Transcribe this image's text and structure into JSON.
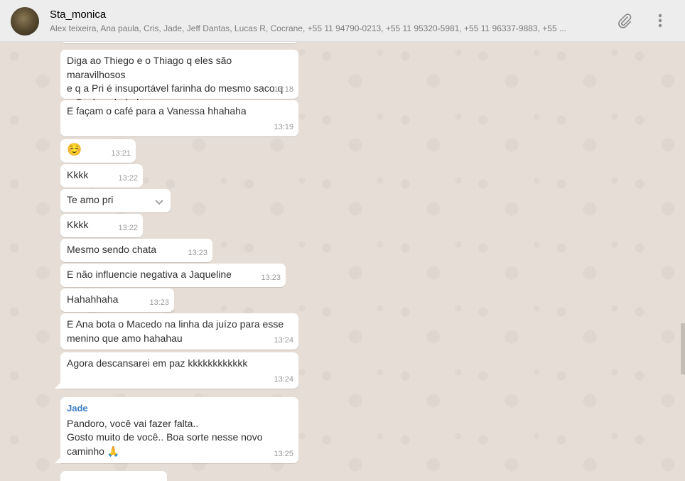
{
  "header": {
    "group_name": "Sta_monica",
    "participants": "Alex teixeira, Ana paula, Cris, Jade, Jeff Dantas, Lucas R, Cocrane, +55 11 94790-0213, +55 11 95320-5981, +55 11 96337-9883, +55 ..."
  },
  "messages": [
    {
      "text": "Diga ao Thiego e o Thiago q eles são maravilhosos\ne q a Pri é insuportável farinha do mesmo saco q\no Coclane hahaha",
      "time": "13:18"
    },
    {
      "text": "E façam o café para a Vanessa hhahaha",
      "time": "13:19"
    },
    {
      "text": "☺️",
      "time": "13:21"
    },
    {
      "text": "Kkkk",
      "time": "13:22"
    },
    {
      "text": "Te amo pri",
      "time": ""
    },
    {
      "text": "Kkkk",
      "time": "13:22"
    },
    {
      "text": "Mesmo sendo chata",
      "time": "13:23"
    },
    {
      "text": "E não influencie negativa a Jaqueline",
      "time": "13:23"
    },
    {
      "text": "Hahahhaha",
      "time": "13:23"
    },
    {
      "text": "E Ana bota o Macedo na linha da juízo para esse\nmenino que amo hahahau",
      "time": "13:24"
    },
    {
      "text": "Agora descansarei em paz kkkkkkkkkkkk",
      "time": "13:24"
    },
    {
      "sender": "Jade",
      "text": "Pandoro, você vai fazer falta..\nGosto muito de você.. Boa sorte nesse novo\ncaminho 🙏",
      "time": "13:25"
    }
  ]
}
